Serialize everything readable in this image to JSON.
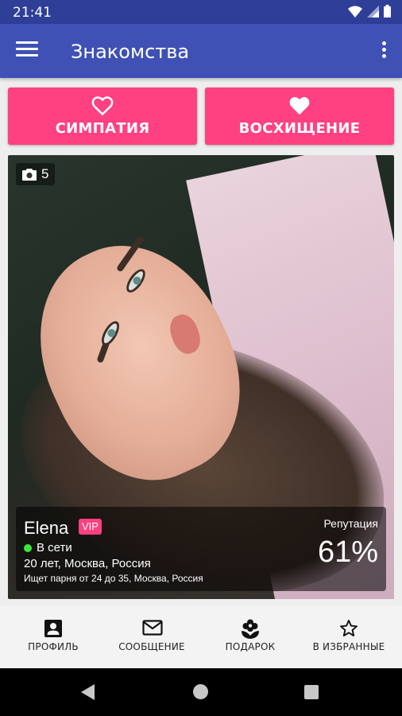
{
  "status_bar": {
    "time": "21:41"
  },
  "app_bar": {
    "title": "Знакомства"
  },
  "actions": {
    "sympathy_label": "СИМПАТИЯ",
    "admiration_label": "ВОСХИЩЕНИЕ"
  },
  "profile": {
    "photo_count": "5",
    "name": "Elena",
    "badge": "VIP",
    "online_status": "В сети",
    "details": "20 лет, Москва, Россия",
    "seeking": "Ищет парня от 24 до 35, Москва, Россия",
    "reputation_label": "Репутация",
    "reputation_value": "61%"
  },
  "bottom_nav": {
    "profile": "ПРОФИЛЬ",
    "message": "СООБЩЕНИЕ",
    "gift": "ПОДАРОК",
    "favorites": "В ИЗБРАННЫЕ"
  },
  "colors": {
    "primary": "#3f51b5",
    "status_bar": "#2f3f98",
    "accent": "#ff4081",
    "online": "#3ce63c"
  }
}
